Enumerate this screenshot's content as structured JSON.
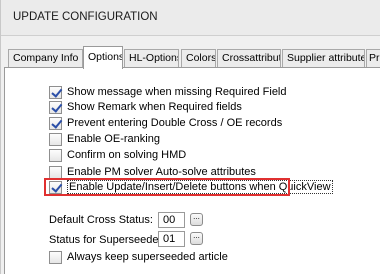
{
  "window": {
    "title": "UPDATE CONFIGURATION"
  },
  "tabs": [
    {
      "label": "Company Info",
      "active": false
    },
    {
      "label": "Options",
      "active": true
    },
    {
      "label": "HL-Options",
      "active": false
    },
    {
      "label": "Colors",
      "active": false
    },
    {
      "label": "Crossattributes",
      "active": false
    },
    {
      "label": "Supplier attributes",
      "active": false
    },
    {
      "label": "Pri",
      "active": false
    }
  ],
  "options": [
    {
      "label": "Show message when missing Required Field",
      "checked": true
    },
    {
      "label": "Show Remark when Required fields",
      "checked": true
    },
    {
      "label": "Prevent entering Double Cross / OE records",
      "checked": true
    },
    {
      "label": "Enable OE-ranking",
      "checked": false
    },
    {
      "label": "Confirm on solving HMD",
      "checked": false
    },
    {
      "label": "Enable PM solver Auto-solve attributes",
      "checked": false
    },
    {
      "label": "Enable Update/Insert/Delete buttons when QuickView",
      "checked": true,
      "highlighted": true
    }
  ],
  "fields": {
    "default_cross_status": {
      "label": "Default Cross Status:",
      "value": "00",
      "button": "..."
    },
    "status_superseeded": {
      "label": "Status for Superseeded:",
      "value": "01",
      "button": "..."
    }
  },
  "keep_superseeded": {
    "label": "Always keep superseeded article",
    "checked": false
  },
  "colors": {
    "highlight": "#e03030",
    "checkmark": "#2b4fa8"
  }
}
